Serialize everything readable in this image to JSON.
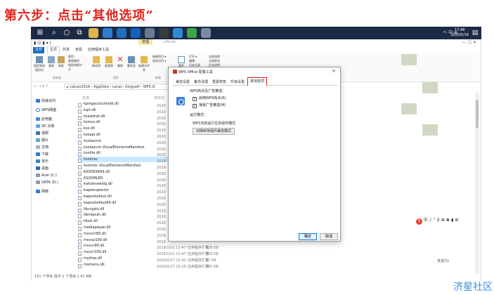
{
  "heading": "第六步：点击“其他选项”",
  "taskbar": {
    "tray_text": "ヘ 中 ⊕",
    "clock_time": "17:48",
    "clock_date": "2020/5/16"
  },
  "explorer": {
    "title_qa": "▮ ☑ ▮ ▾ |",
    "manage_tab": "管理",
    "app_label": "office6",
    "tabs": [
      "文件",
      "主页",
      "共享",
      "查看",
      "应用程序工具"
    ],
    "ribbon": {
      "pin": "固定到快速访问",
      "copy": "复制",
      "paste": "粘贴",
      "cut": "剪切",
      "copy_path": "复制路径",
      "paste_shortcut": "粘贴快捷方式",
      "move_to": "移动到",
      "copy_to": "复制到",
      "delete": "删除",
      "rename": "重命名",
      "new_folder": "新建文件夹",
      "new_item": "新建项目 ▾",
      "easy_access": "轻松访问 ▾",
      "properties": "属性",
      "open": "打开 ▾",
      "edit": "编辑",
      "history": "历史记录",
      "select_all": "全部选择",
      "select_none": "全部取消",
      "invert": "反向选择",
      "group_clipboard": "剪贴板",
      "group_organize": "组织",
      "group_new": "新建",
      "group_open": "打开",
      "group_select": "选择"
    },
    "address": {
      "navs": "← → ▾ ↑",
      "path": "▸ caican2016 › AppData › Local › Kingsoft › WPS O"
    },
    "nav_items": [
      "快速访问",
      "WPS网盘",
      "此电脑",
      "3D 对象",
      "视频",
      "图片",
      "文档",
      "下载",
      "音乐",
      "桌面",
      "Acer (C:)",
      "DATA (D:)",
      "网络"
    ],
    "columns": {
      "name": "名称",
      "date": "修改日"
    },
    "files": [
      {
        "name": "kpingaccountsdk.dll",
        "date": "2020",
        "type": "",
        "size": ""
      },
      {
        "name": "kqrt.dll",
        "date": "2020",
        "type": "",
        "size": ""
      },
      {
        "name": "ksaddndr.dll",
        "date": "2020",
        "type": "",
        "size": ""
      },
      {
        "name": "ksmso.dll",
        "date": "2020",
        "type": "",
        "size": ""
      },
      {
        "name": "kso.dll",
        "date": "2020",
        "type": "",
        "size": ""
      },
      {
        "name": "ksoapi.dll",
        "date": "2020",
        "type": "",
        "size": ""
      },
      {
        "name": "ksolaunch",
        "date": "2020",
        "type": "",
        "size": ""
      },
      {
        "name": "ksolaunch.VisualElementsManifest",
        "date": "2020",
        "type": "",
        "size": ""
      },
      {
        "name": "ksolite.dll",
        "date": "2020",
        "type": "",
        "size": ""
      },
      {
        "name": "ksomisc",
        "date": "2019",
        "type": "",
        "size": ""
      },
      {
        "name": "ksomisc.VisualElementsManifest",
        "date": "2019",
        "type": "",
        "size": ""
      },
      {
        "name": "KSOXEXE64.dll",
        "date": "2020",
        "type": "",
        "size": ""
      },
      {
        "name": "KSOXMLED",
        "date": "2020",
        "type": "",
        "size": ""
      },
      {
        "name": "kwhatnewdlg.dll",
        "date": "2020",
        "type": "",
        "size": ""
      },
      {
        "name": "kwpsinspector",
        "date": "2020",
        "type": "",
        "size": ""
      },
      {
        "name": "kwpsshellext.dll",
        "date": "2020",
        "type": "",
        "size": ""
      },
      {
        "name": "kwpsshellext64.dll",
        "date": "2020",
        "type": "",
        "size": ""
      },
      {
        "name": "libcrypto.dll",
        "date": "2020",
        "type": "",
        "size": ""
      },
      {
        "name": "libmipush.dll",
        "date": "2020",
        "type": "",
        "size": ""
      },
      {
        "name": "libssl.dll",
        "date": "2020",
        "type": "",
        "size": ""
      },
      {
        "name": "mediaplayer.dll",
        "date": "2020",
        "type": "",
        "size": ""
      },
      {
        "name": "msvcm80.dll",
        "date": "2019",
        "type": "",
        "size": ""
      },
      {
        "name": "msvcp100.dll",
        "date": "2019",
        "type": "",
        "size": ""
      },
      {
        "name": "msvcr90.dll",
        "date": "2019/10/1 12:47",
        "type": "应用程序扩展",
        "size": "638 KB"
      },
      {
        "name": "msvcr100.dll",
        "date": "2019/10/1 12:47",
        "type": "应用程序扩展",
        "size": "756 KB"
      },
      {
        "name": "mythes.dll",
        "date": "2020/2/27 23:42",
        "type": "应用程序扩展",
        "size": "27 KB"
      },
      {
        "name": "mxmenu.dll",
        "date": "2020/2/27 23:29",
        "type": "应用程序扩展",
        "size": "480 KB"
      }
    ],
    "status": "151 个项目   选中 1 个项目  1.61 MB"
  },
  "dialog": {
    "title": "WPS Office 配置工具",
    "close": "×",
    "tabs": [
      "兼容设置",
      "备份清理",
      "重置修复",
      "升级设置",
      "其他选项"
    ],
    "section1": "WPS热点及广告推送：",
    "opt1": "启用WPS热点(R)",
    "opt2": "接受广告推送(M)",
    "section2": "运行模式：",
    "mode_text": "WPS当前运行在多组件模式",
    "mode_button": "切换到单组件兼容模式",
    "ok": "确定",
    "cancel": "取消"
  },
  "ime": {
    "logo": "S",
    "text": "中 ♪ ° ♀ ⊞ ♣ ▮ ⊞"
  },
  "sidebar_right": {
    "label": "发送(S)"
  },
  "watermark": "济星社区"
}
